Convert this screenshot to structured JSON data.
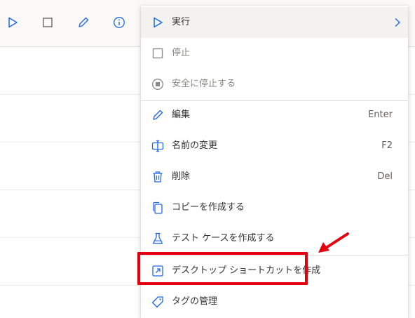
{
  "toolbar": {
    "icons": [
      "play-icon",
      "stop-icon",
      "edit-icon",
      "info-icon"
    ]
  },
  "menu": {
    "items": [
      {
        "icon": "play-icon",
        "label": "実行",
        "shortcut": "",
        "submenu": true,
        "disabled": false
      },
      {
        "icon": "stop-icon",
        "label": "停止",
        "shortcut": "",
        "disabled": true
      },
      {
        "icon": "stop-circle-icon",
        "label": "安全に停止する",
        "shortcut": "",
        "disabled": true
      },
      {
        "icon": "pencil-icon",
        "label": "編集",
        "shortcut": "Enter",
        "disabled": false
      },
      {
        "icon": "rename-icon",
        "label": "名前の変更",
        "shortcut": "F2",
        "disabled": false
      },
      {
        "icon": "trash-icon",
        "label": "削除",
        "shortcut": "Del",
        "disabled": false
      },
      {
        "icon": "copy-icon",
        "label": "コピーを作成する",
        "shortcut": "",
        "disabled": false
      },
      {
        "icon": "flask-icon",
        "label": "テスト ケースを作成する",
        "shortcut": "",
        "disabled": false
      },
      {
        "icon": "external-link-icon",
        "label": "デスクトップ ショートカットを作成",
        "shortcut": "",
        "disabled": false,
        "highlighted": true
      },
      {
        "icon": "tag-icon",
        "label": "タグの管理",
        "shortcut": "",
        "disabled": false
      }
    ]
  },
  "colors": {
    "accent": "#2266e3",
    "annotation": "#e3000f",
    "disabled": "#8a8886"
  }
}
